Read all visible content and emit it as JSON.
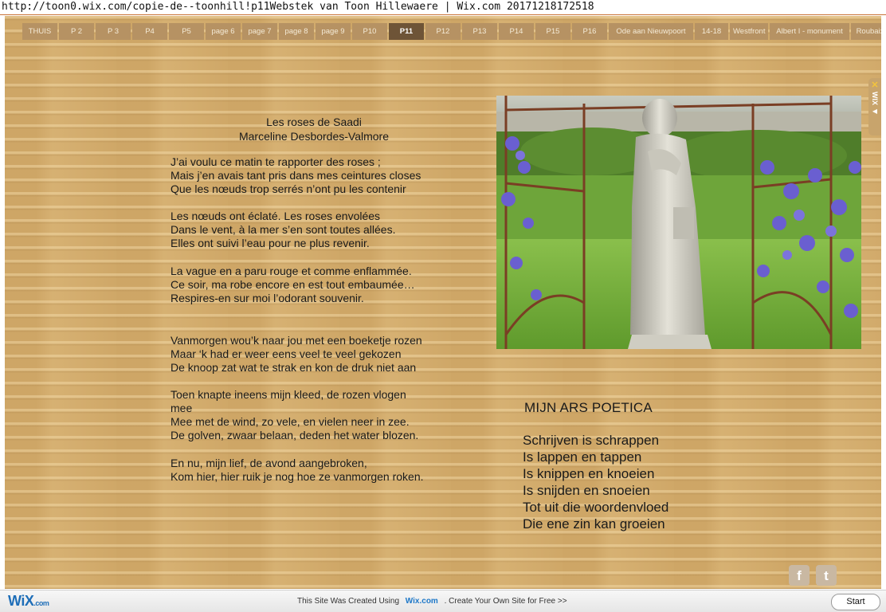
{
  "browser": {
    "url_line": "http://toon0.wix.com/copie-de--toonhill!p11Webstek van Toon Hillewaere | Wix.com 20171218172518"
  },
  "nav": {
    "items": [
      "THUIS",
      "P 2",
      "P 3",
      "P4",
      "P5",
      "page 6",
      "page 7",
      "page 8",
      "page 9",
      "P10",
      "P11",
      "P12",
      "P13",
      "P14",
      "P15",
      "P16",
      "Ode aan Nieuwpoort",
      "14-18",
      "Westfront",
      "Albert  I - monument",
      "Roubaix"
    ],
    "active": "P11"
  },
  "poem_fr": {
    "title": "Les roses de Saadi",
    "author": "Marceline Desbordes-Valmore",
    "stanza1": [
      "J’ai voulu ce matin te rapporter des roses ;",
      "Mais j’en avais tant pris dans mes ceintures closes",
      "Que les nœuds trop serrés n’ont pu les contenir"
    ],
    "stanza2": [
      "Les nœuds ont éclaté. Les roses envolées",
      "Dans le vent, à la mer s’en sont toutes allées.",
      "Elles ont suivi l’eau pour ne plus revenir."
    ],
    "stanza3": [
      "La vague en a paru rouge et comme enflammée.",
      "Ce soir, ma robe encore en est tout embaumée…",
      "Respires-en sur moi l’odorant souvenir."
    ]
  },
  "poem_nl": {
    "stanza1": [
      "Vanmorgen wou’k naar jou met een boeketje rozen",
      "Maar ‘k had er weer eens veel te veel gekozen",
      "De knoop zat wat te strak en kon de druk niet aan"
    ],
    "stanza2": [
      "Toen knapte ineens mijn kleed, de rozen vlogen",
      "mee",
      "Mee met de wind, zo vele,  en vielen  neer in zee.",
      "De golven, zwaar belaan,  deden het water blozen."
    ],
    "stanza3": [
      "En nu, mijn lief, de avond aangebroken,",
      "Kom hier, hier ruik je nog hoe ze vanmorgen roken."
    ]
  },
  "ars_poetica": {
    "title": "MIJN ARS POETICA",
    "lines": [
      "Schrijven is schrappen",
      "Is lappen en tappen",
      "Is knippen en knoeien",
      "Is snijden en snoeien",
      "Tot uit die woordenvloed",
      "Die ene zin kan groeien"
    ]
  },
  "side_tab": {
    "label": "WIX"
  },
  "social": {
    "facebook": "f",
    "twitter": "t"
  },
  "footer": {
    "logo": "WiX",
    "logo_suffix": ".com",
    "text_before": "This Site Was Created Using",
    "link": "Wix.com",
    "text_after": ". Create Your Own Site for Free >>",
    "start": "Start"
  },
  "colors": {
    "background": "#d2ab6b",
    "nav": "#b69263",
    "nav_active": "#6e5437",
    "wix_blue": "#1e6eb8"
  },
  "icons": [
    "facebook-icon",
    "twitter-icon",
    "wix-x-icon",
    "arrow-icon"
  ]
}
